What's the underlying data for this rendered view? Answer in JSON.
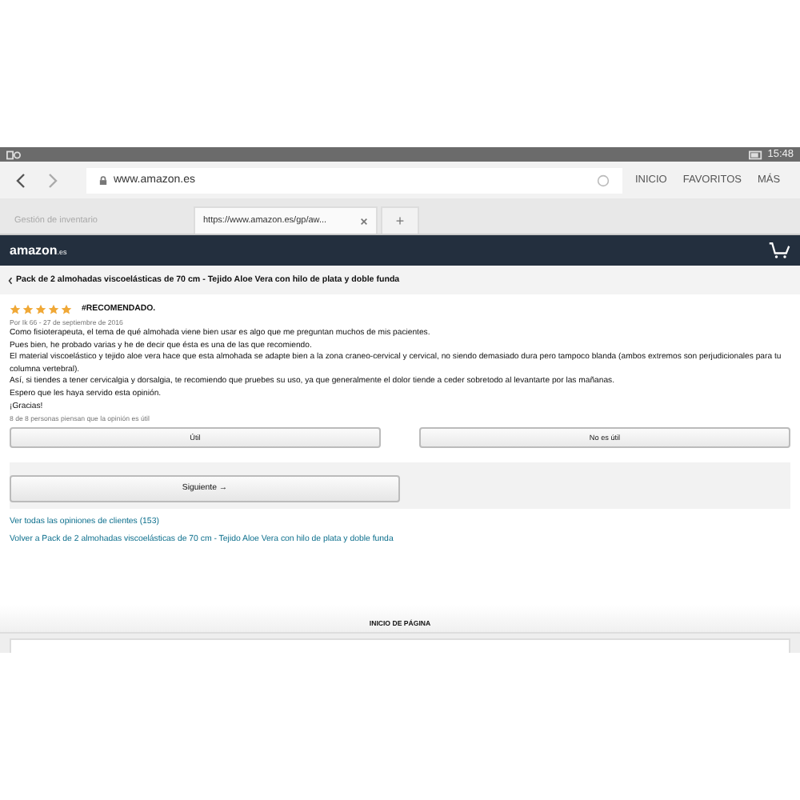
{
  "status_bar": {
    "time": "15:48"
  },
  "browser": {
    "url": "www.amazon.es",
    "menu": [
      "INICIO",
      "FAVORITOS",
      "MÁS"
    ],
    "tabs": [
      {
        "label": "Gestión de inventario",
        "selected": false
      },
      {
        "label": "https://www.amazon.es/gp/aw...",
        "selected": true
      }
    ],
    "new_tab": "+"
  },
  "header": {
    "logo": "amazon",
    "logo_suffix": ".es"
  },
  "breadcrumb": "Pack de 2 almohadas viscoelásticas de 70 cm - Tejido Aloe Vera con hilo de plata y doble funda",
  "review": {
    "stars": 5,
    "title": "#RECOMENDADO.",
    "byline": "Por Ik 66 - 27 de septiembre de 2016",
    "lines": [
      "Como fisioterapeuta, el tema de qué almohada viene bien usar es algo que me preguntan muchos de mis pacientes.",
      "Pues bien, he probado varias y he de decir que ésta es una de las que recomiendo.",
      "El material viscoelástico y tejido aloe vera hace que esta almohada se adapte bien a la zona craneo-cervical y cervical, no siendo demasiado dura pero tampoco blanda (ambos extremos son perjudicionales para tu columna vertebral).",
      "Así, si tiendes a tener cervicalgia y dorsalgia, te recomiendo que pruebes su uso, ya que generalmente el dolor tiende a ceder sobretodo al levantarte por las mañanas.",
      "Espero que les haya servido esta opinión.",
      "¡Gracias!"
    ],
    "helpful": "8 de 8 personas piensan que la opinión es útil"
  },
  "vote_buttons": [
    "Útil",
    "No es útil"
  ],
  "next_button": "Siguiente →",
  "links": [
    "Ver todas las opiniones de clientes (153)",
    "Volver a Pack de 2 almohadas viscoelásticas de 70 cm - Tejido Aloe Vera con hilo de plata y doble funda"
  ],
  "back_to_top": "INICIO DE PÁGINA"
}
